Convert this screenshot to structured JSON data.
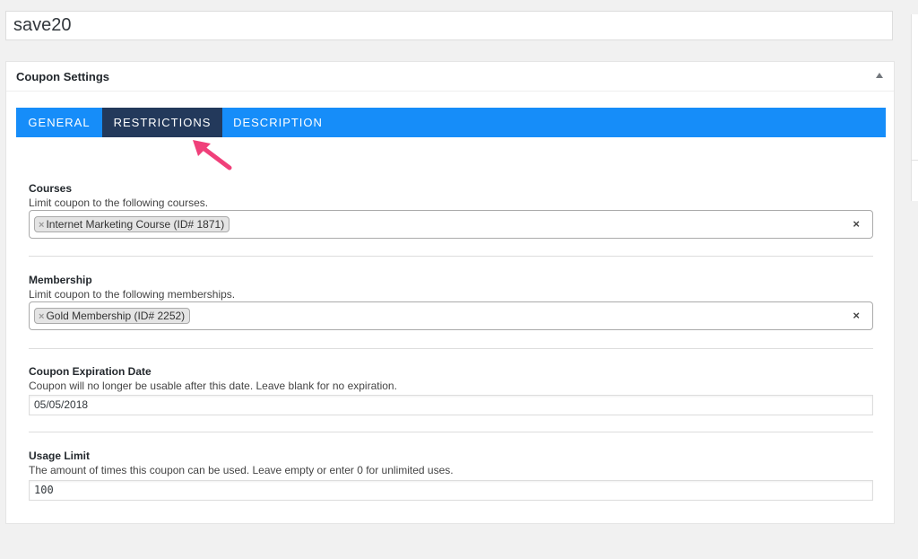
{
  "title_input": {
    "value": "save20"
  },
  "postbox": {
    "title": "Coupon Settings"
  },
  "tabs": [
    {
      "label": "GENERAL",
      "active": false
    },
    {
      "label": "RESTRICTIONS",
      "active": true
    },
    {
      "label": "DESCRIPTION",
      "active": false
    }
  ],
  "fields": {
    "courses": {
      "label": "Courses",
      "description": "Limit coupon to the following courses.",
      "selected": "Internet Marketing Course (ID# 1871)"
    },
    "membership": {
      "label": "Membership",
      "description": "Limit coupon to the following memberships.",
      "selected": "Gold Membership (ID# 2252)"
    },
    "expiration": {
      "label": "Coupon Expiration Date",
      "description": "Coupon will no longer be usable after this date. Leave blank for no expiration.",
      "value": "05/05/2018"
    },
    "usage_limit": {
      "label": "Usage Limit",
      "description": "The amount of times this coupon can be used. Leave empty or enter 0 for unlimited uses.",
      "value": "100"
    }
  },
  "glyphs": {
    "remove": "×",
    "clear": "×"
  },
  "colors": {
    "tab_bar": "#168df9",
    "tab_active": "#23395b",
    "arrow": "#f0407a"
  },
  "icons": {
    "toggle": "triangle-up-icon",
    "annotation": "arrow-annotation-icon"
  }
}
